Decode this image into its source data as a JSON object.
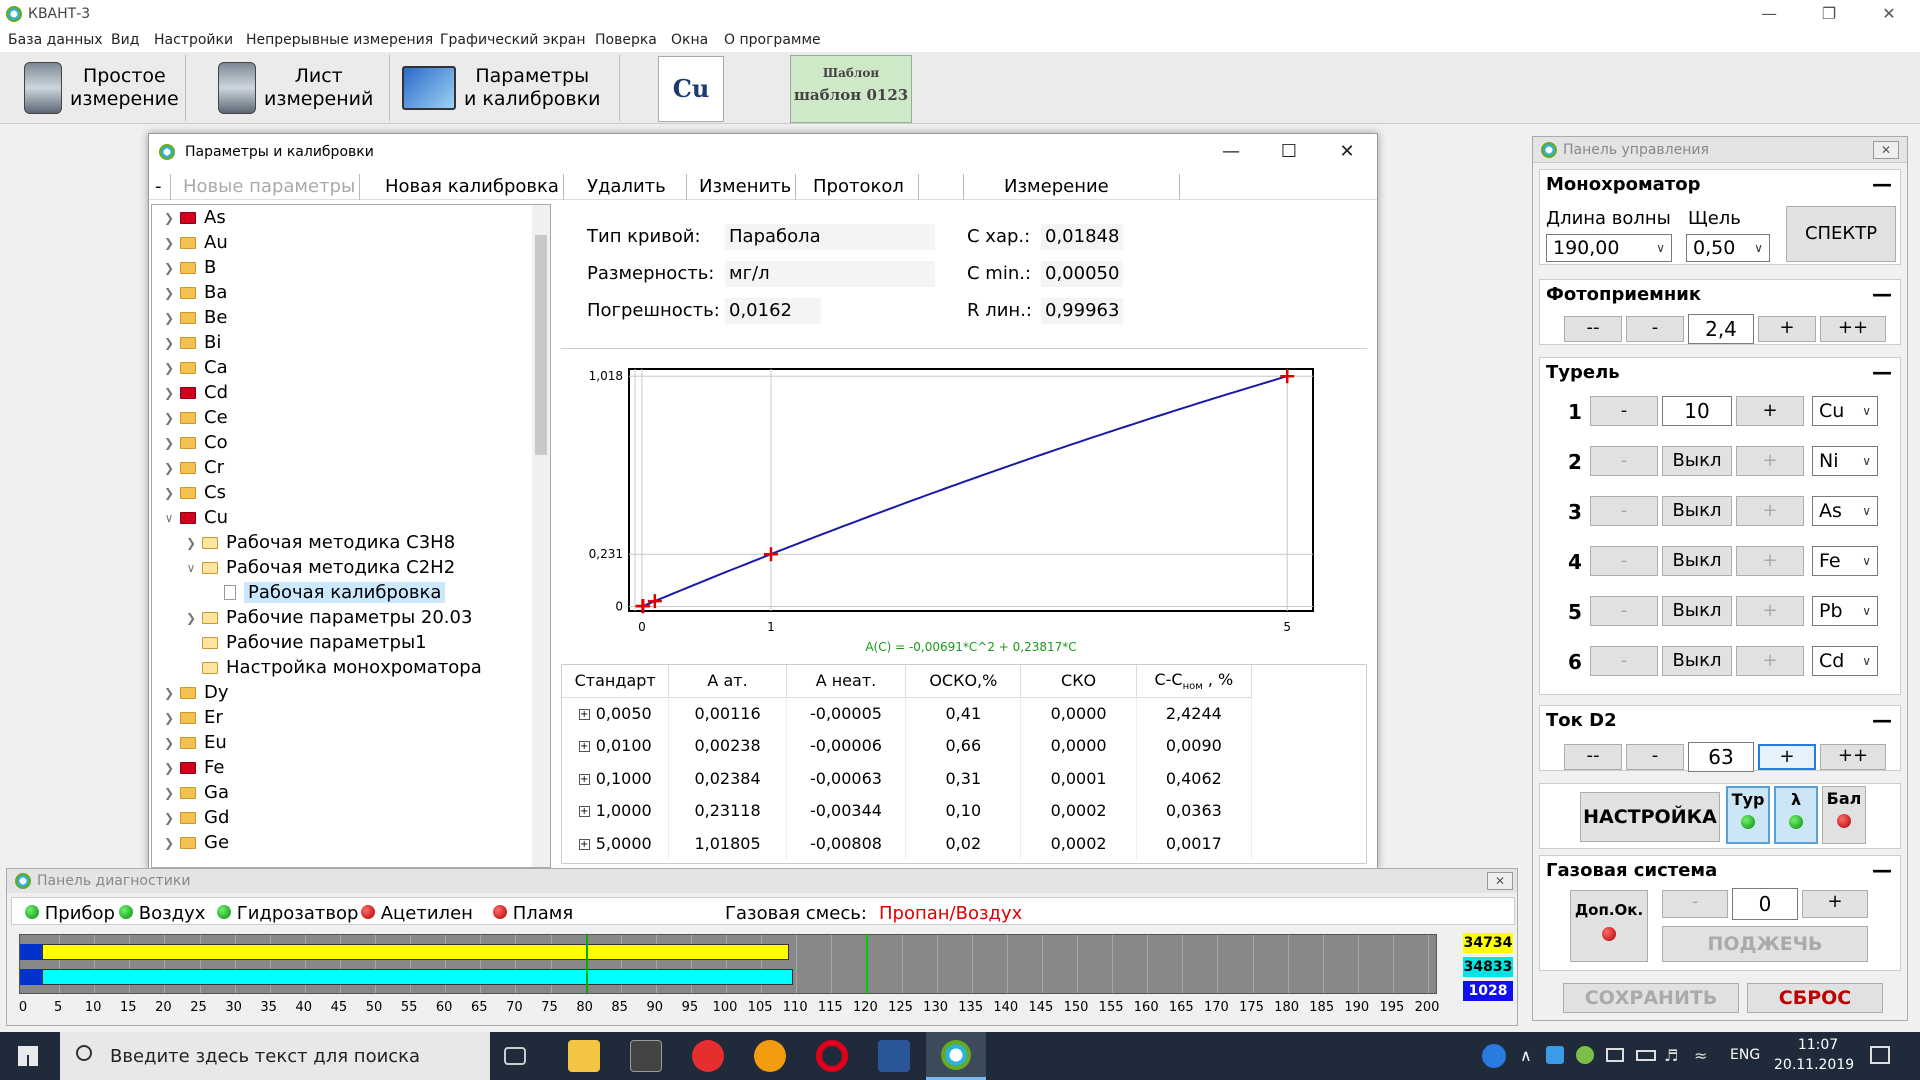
{
  "window": {
    "title": "КВАНТ-3"
  },
  "menu": [
    "База данных",
    "Вид",
    "Настройки",
    "Непрерывные измерения",
    "Графический экран",
    "Поверка",
    "Окна",
    "О программе"
  ],
  "toolbar": {
    "simple_measure": "Простое\nизмерение",
    "measure_sheet": "Лист\nизмерений",
    "params_calib": "Параметры\nи калибровки",
    "element": "Cu",
    "template_label": "Шаблон",
    "template_name": "шаблон 0123"
  },
  "dialog": {
    "title": "Параметры и калибровки",
    "menu": {
      "dash": "-",
      "new_params": "Новые параметры",
      "new_calib": "Новая калибровка",
      "delete": "Удалить",
      "edit": "Изменить",
      "protocol": "Протокол",
      "measure": "Измерение"
    },
    "tree": {
      "elements": [
        "As",
        "Au",
        "B",
        "Ba",
        "Be",
        "Bi",
        "Ca",
        "Cd",
        "Ce",
        "Co",
        "Cr",
        "Cs",
        "Cu"
      ],
      "cu_children": [
        "Рабочая методика C3H8",
        "Рабочая методика C2H2"
      ],
      "calib": "Рабочая калибровка",
      "cu_more": [
        "Рабочие параметры 20.03",
        "Рабочие параметры1",
        "Настройка монохроматора"
      ],
      "elements2": [
        "Dy",
        "Er",
        "Eu",
        "Fe",
        "Ga",
        "Gd",
        "Ge"
      ]
    },
    "params": {
      "curve_type_label": "Тип кривой:",
      "curve_type": "Парабола",
      "dimension_label": "Размерность:",
      "dimension": "мг/л",
      "error_label": "Погрешность:",
      "error": "0,0162",
      "c_char_label": "C хар.:",
      "c_char": "0,01848",
      "c_min_label": "C min.:",
      "c_min": "0,00050",
      "r_lin_label": "R лин.:",
      "r_lin": "0,99963"
    },
    "table": {
      "headers": [
        "Стандарт",
        "A ат.",
        "A неат.",
        "ОСКО,%",
        "СКО",
        "C-C",
        "ном",
        " , %"
      ],
      "rows": [
        [
          "0,0050",
          "0,00116",
          "-0,00005",
          "0,41",
          "0,0000",
          "2,4244"
        ],
        [
          "0,0100",
          "0,00238",
          "-0,00006",
          "0,66",
          "0,0000",
          "0,0090"
        ],
        [
          "0,1000",
          "0,02384",
          "-0,00063",
          "0,31",
          "0,0001",
          "0,4062"
        ],
        [
          "1,0000",
          "0,23118",
          "-0,00344",
          "0,10",
          "0,0002",
          "0,0363"
        ],
        [
          "5,0000",
          "1,01805",
          "-0,00808",
          "0,02",
          "0,0002",
          "0,0017"
        ]
      ],
      "plus": "+"
    }
  },
  "chart_data": {
    "type": "line",
    "title": "",
    "formula": "A(C) = -0,00691*C^2 + 0,23817*C",
    "x_ticks": [
      "0",
      "1",
      "5"
    ],
    "y_ticks": [
      "0",
      "0,231",
      "1,018"
    ],
    "xlim": [
      -0.1,
      5.2
    ],
    "ylim": [
      -0.02,
      1.05
    ],
    "points": [
      [
        0.005,
        0.00116
      ],
      [
        0.01,
        0.00238
      ],
      [
        0.1,
        0.02384
      ],
      [
        1.0,
        0.23118
      ],
      [
        5.0,
        1.01805
      ]
    ],
    "curve": {
      "a2": -0.00691,
      "a1": 0.23817
    },
    "line_color": "#1a1aa8",
    "marker_color": "#e00000",
    "formula_color": "#1a9a1a"
  },
  "control_panel": {
    "title": "Панель управления",
    "mono": {
      "title": "Монохроматор",
      "wl_label": "Длина волны",
      "slit_label": "Щель",
      "wl": "190,00",
      "slit": "0,50",
      "spectr": "СПЕКТР"
    },
    "photo": {
      "title": "Фотоприемник",
      "mm": "--",
      "m": "-",
      "value": "2,4",
      "p": "+",
      "pp": "++"
    },
    "turret": {
      "title": "Турель",
      "rows": [
        {
          "n": "1",
          "value": "10",
          "el": "Cu"
        },
        {
          "n": "2",
          "value": "Выкл",
          "el": "Ni"
        },
        {
          "n": "3",
          "value": "Выкл",
          "el": "As"
        },
        {
          "n": "4",
          "value": "Выкл",
          "el": "Fe"
        },
        {
          "n": "5",
          "value": "Выкл",
          "el": "Pb"
        },
        {
          "n": "6",
          "value": "Выкл",
          "el": "Cd"
        }
      ],
      "minus": "-",
      "plus": "+"
    },
    "d2": {
      "title": "Ток D2",
      "mm": "--",
      "m": "-",
      "value": "63",
      "p": "+",
      "pp": "++"
    },
    "setup": {
      "label": "НАСТРОЙКА",
      "tur": "Тур",
      "lambda": "λ",
      "bal": "Бал"
    },
    "gas": {
      "title": "Газовая система",
      "extra": "Доп.Ок.",
      "minus": "-",
      "value": "0",
      "plus": "+",
      "ignite": "ПОДЖЕЧЬ"
    },
    "save": "СОХРАНИТЬ",
    "reset": "СБРОС",
    "minus_glyph": "—",
    "close_glyph": "✕"
  },
  "diagnostics": {
    "title": "Панель диагностики",
    "status": [
      {
        "label": "Прибор",
        "ok": true
      },
      {
        "label": "Воздух",
        "ok": true
      },
      {
        "label": "Гидрозатвор",
        "ok": true
      },
      {
        "label": "Ацетилен",
        "ok": false
      },
      {
        "label": "Пламя",
        "ok": false
      }
    ],
    "gas_mix_label": "Газовая смесь:",
    "gas_mix": "Пропан/Воздух",
    "scale": [
      "0",
      "5",
      "10",
      "15",
      "20",
      "25",
      "30",
      "35",
      "40",
      "45",
      "50",
      "55",
      "60",
      "65",
      "70",
      "75",
      "80",
      "85",
      "90",
      "95",
      "100",
      "105",
      "110",
      "115",
      "120",
      "125",
      "130",
      "135",
      "140",
      "145",
      "150",
      "155",
      "160",
      "165",
      "170",
      "175",
      "180",
      "185",
      "190",
      "195",
      "200"
    ],
    "bar_yellow_value": 109,
    "bar_cyan_value": 109.5,
    "marker_value": 80,
    "green_line_value": 120,
    "counts": [
      "34734",
      "34833",
      "1028"
    ]
  },
  "taskbar": {
    "search": "Введите здесь текст для поиска",
    "time": "11:07",
    "date": "20.11.2019",
    "lang": "ENG"
  }
}
